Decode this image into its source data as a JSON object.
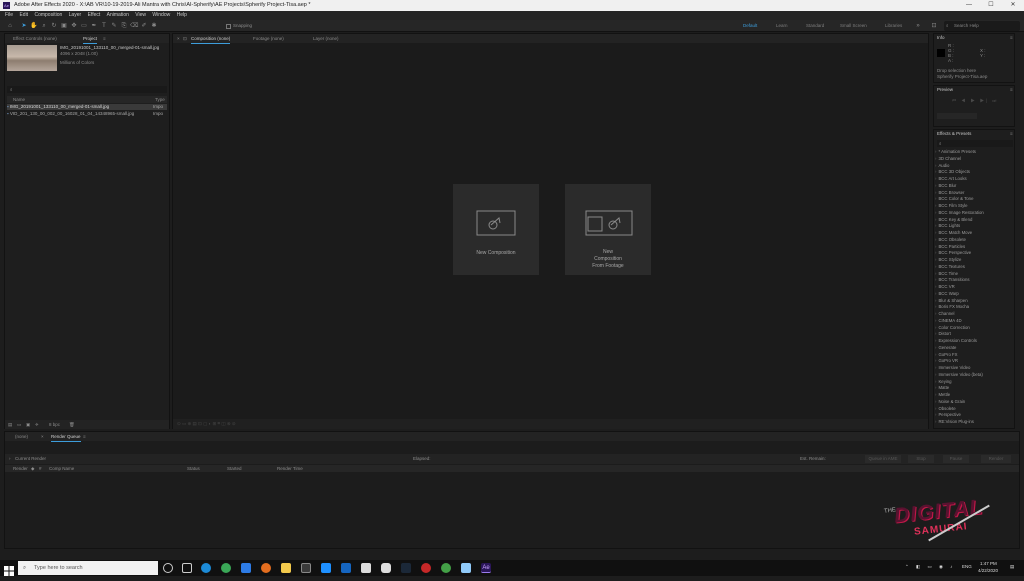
{
  "titlebar": {
    "title": "Adobe After Effects 2020 - X:\\AB VR\\10-19-2019-Ali Mantra with Chris\\AI-Spherify\\AE Projects\\Spherify Project-Tisa.aep *",
    "minimize": "—",
    "maximize": "☐",
    "close": "✕"
  },
  "menu": [
    "File",
    "Edit",
    "Composition",
    "Layer",
    "Effect",
    "Animation",
    "View",
    "Window",
    "Help"
  ],
  "toolbar": {
    "snapping": "Snapping",
    "workspaces": [
      "Default",
      "Learn",
      "Standard",
      "Small Screen",
      "Libraries"
    ],
    "active_workspace": "Default",
    "search_placeholder": "Search Help"
  },
  "project_panel": {
    "tabs": [
      "Effect Controls (none)",
      "Project"
    ],
    "active_tab": "Project",
    "selected_name": "IMG_20191001_133110_00_merged-01-small.jpg",
    "selected_info": "4096 x 2048 (1.00)",
    "selected_colors": "Millions of Colors",
    "search_icon": "search-icon",
    "header_name": "Name",
    "header_type": "Type",
    "items": [
      {
        "name": "IMG_20191001_133110_00_merged-01-small.jpg",
        "type": "Impo"
      },
      {
        "name": "VID_201_130_00_002_00_16028_01_04_14348965-small.jpg",
        "type": "Impo"
      }
    ],
    "bpc": "8 bpc"
  },
  "composition_panel": {
    "tabs": [
      "Composition (none)",
      "Footage (none)",
      "Layer (none)"
    ],
    "active_tab": "Composition (none)",
    "cards": [
      {
        "label_lines": [
          "New Composition"
        ]
      },
      {
        "label_lines": [
          "New",
          "Composition",
          "From Footage"
        ]
      }
    ]
  },
  "info_panel": {
    "title": "Info",
    "r": "R :",
    "g": "G :",
    "b": "B :",
    "a": "A :",
    "x": "X :",
    "y": "Y :",
    "hint1": "Drop selection here",
    "hint2": "Spherify Project-Tisa.aep"
  },
  "preview_panel": {
    "title": "Preview"
  },
  "effects_panel": {
    "title": "Effects & Presets",
    "items": [
      "* Animation Presets",
      "3D Channel",
      "Audio",
      "BCC 3D Objects",
      "BCC Art Looks",
      "BCC Blur",
      "BCC Browser",
      "BCC Color & Tone",
      "BCC Film Style",
      "BCC Image Restoration",
      "BCC Key & Blend",
      "BCC Lights",
      "BCC Match Move",
      "BCC Obsolete",
      "BCC Particles",
      "BCC Perspective",
      "BCC Stylize",
      "BCC Textures",
      "BCC Time",
      "BCC Transitions",
      "BCC VR",
      "BCC Warp",
      "Blur & Sharpen",
      "Boris FX Mocha",
      "Channel",
      "CINEMA 4D",
      "Color Correction",
      "Distort",
      "Expression Controls",
      "Generate",
      "GoPro FX",
      "GoPro VR",
      "Immersive Video",
      "Immersive Video (beta)",
      "Keying",
      "Matte",
      "Mettle",
      "Noise & Grain",
      "Obsolete",
      "Perspective",
      "RE:Vision Plug-ins"
    ]
  },
  "timeline": {
    "tabs": [
      "(none)",
      "Render Queue"
    ],
    "active_tab": "Render Queue",
    "current_render": "Current Render",
    "elapsed": "Elapsed:",
    "est_remain": "Est. Remain:",
    "queue_in_ame": "Queue in AME",
    "stop": "Stop",
    "pause": "Pause",
    "render": "Render",
    "columns": [
      "Render",
      "Comp Name",
      "Status",
      "Started",
      "Render Time"
    ]
  },
  "watermark": {
    "line1": "DIGITAL",
    "line2": "SAMURAI",
    "prefix": "THE"
  },
  "taskbar": {
    "search": "Type here to search",
    "time": "1:47 PM",
    "date": "4/22/2020",
    "lang": "ENG"
  }
}
